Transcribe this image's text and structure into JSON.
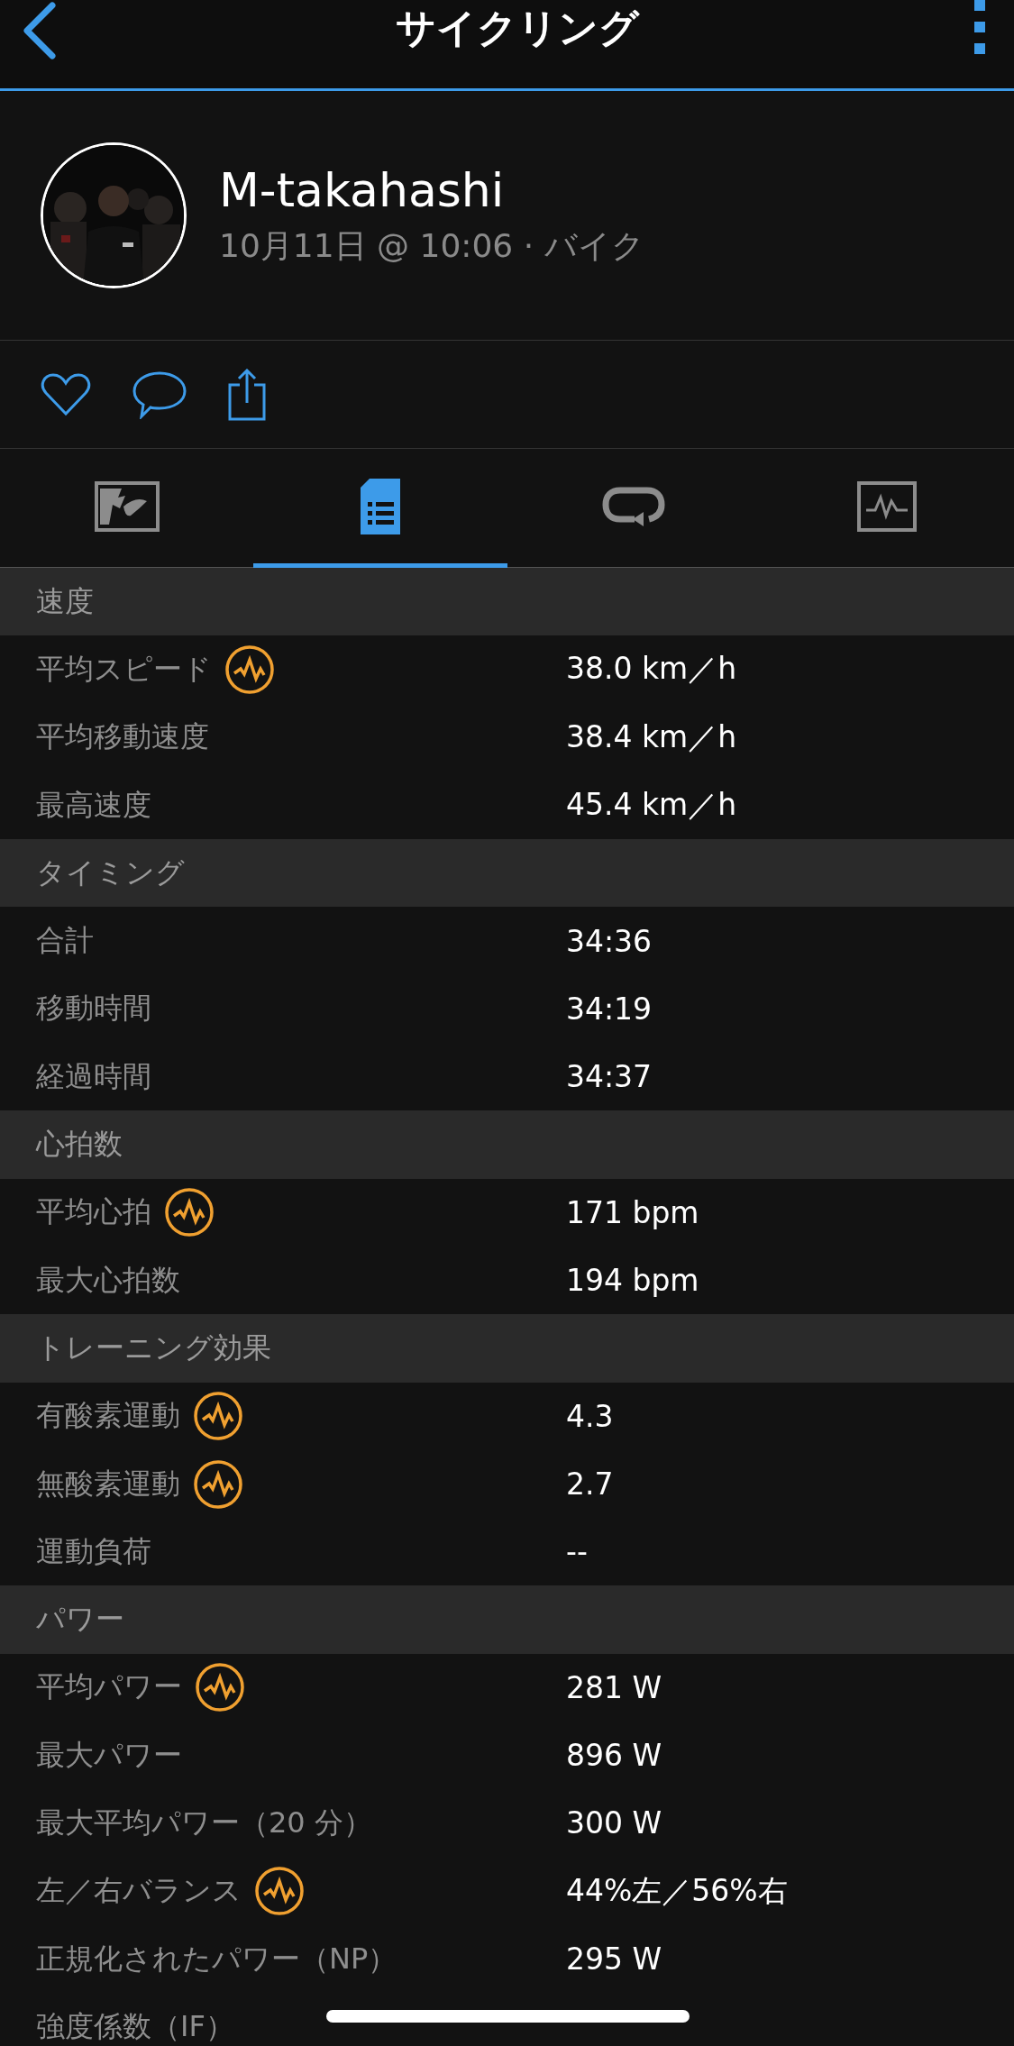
{
  "header": {
    "title": "サイクリング"
  },
  "profile": {
    "name": "M-takahashi",
    "meta": "10月11日 @ 10:06 · バイク"
  },
  "tabs": [
    {
      "kind": "map",
      "selected": false
    },
    {
      "kind": "stats",
      "selected": true
    },
    {
      "kind": "laps",
      "selected": false
    },
    {
      "kind": "chart",
      "selected": false
    }
  ],
  "sections": [
    {
      "title": "速度",
      "rows": [
        {
          "label": "平均スピード",
          "value": "38.0 km／h",
          "badge": true
        },
        {
          "label": "平均移動速度",
          "value": "38.4 km／h",
          "badge": false
        },
        {
          "label": "最高速度",
          "value": "45.4 km／h",
          "badge": false
        }
      ]
    },
    {
      "title": "タイミング",
      "rows": [
        {
          "label": "合計",
          "value": "34:36",
          "badge": false
        },
        {
          "label": "移動時間",
          "value": "34:19",
          "badge": false
        },
        {
          "label": "経過時間",
          "value": "34:37",
          "badge": false
        }
      ]
    },
    {
      "title": "心拍数",
      "rows": [
        {
          "label": "平均心拍",
          "value": "171 bpm",
          "badge": true
        },
        {
          "label": "最大心拍数",
          "value": "194 bpm",
          "badge": false
        }
      ]
    },
    {
      "title": "トレーニング効果",
      "rows": [
        {
          "label": "有酸素運動",
          "value": "4.3",
          "badge": true
        },
        {
          "label": "無酸素運動",
          "value": "2.7",
          "badge": true
        },
        {
          "label": "運動負荷",
          "value": "--",
          "badge": false
        }
      ]
    },
    {
      "title": "パワー",
      "rows": [
        {
          "label": "平均パワー",
          "value": "281 W",
          "badge": true
        },
        {
          "label": "最大パワー",
          "value": "896 W",
          "badge": false
        },
        {
          "label": "最大平均パワー（20 分）",
          "value": "300 W",
          "badge": false
        },
        {
          "label": "左／右バランス",
          "value": "44%左／56%右",
          "badge": true
        },
        {
          "label": "正規化されたパワー（NP）",
          "value": "295 W",
          "badge": false
        },
        {
          "label": "強度係数（IF）",
          "badge": false
        }
      ]
    }
  ]
}
